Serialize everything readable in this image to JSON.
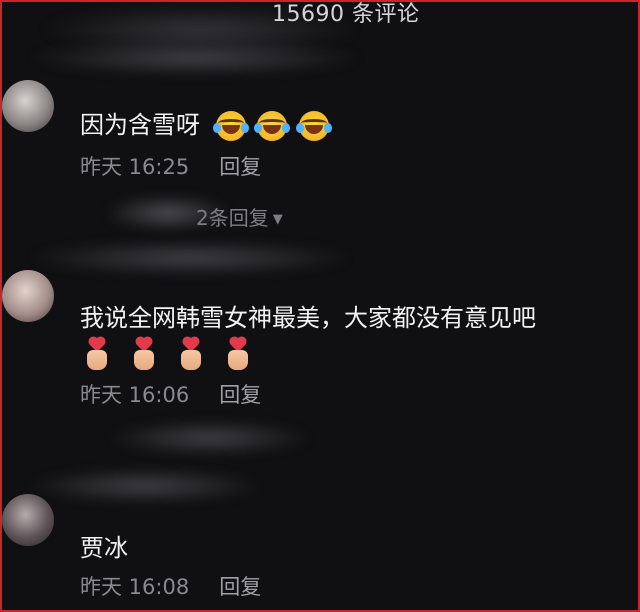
{
  "header": {
    "comment_count": "15690 条评论"
  },
  "comments": [
    {
      "text": "因为含雪呀",
      "emojis": [
        "laughing-crying-emoji",
        "laughing-crying-emoji",
        "laughing-crying-emoji"
      ],
      "time": "昨天 16:25",
      "reply_label": "回复",
      "replies_toggle": "2条回复"
    },
    {
      "text": "我说全网韩雪女神最美，大家都没有意见吧",
      "emojis": [
        "finger-heart-emoji",
        "finger-heart-emoji",
        "finger-heart-emoji",
        "finger-heart-emoji"
      ],
      "time": "昨天 16:06",
      "reply_label": "回复"
    },
    {
      "text": "贾冰",
      "time": "昨天 16:08",
      "reply_label": "回复"
    }
  ],
  "colors": {
    "background": "#101012",
    "frame": "#c8262a",
    "meta_text": "#8a8a8e"
  }
}
